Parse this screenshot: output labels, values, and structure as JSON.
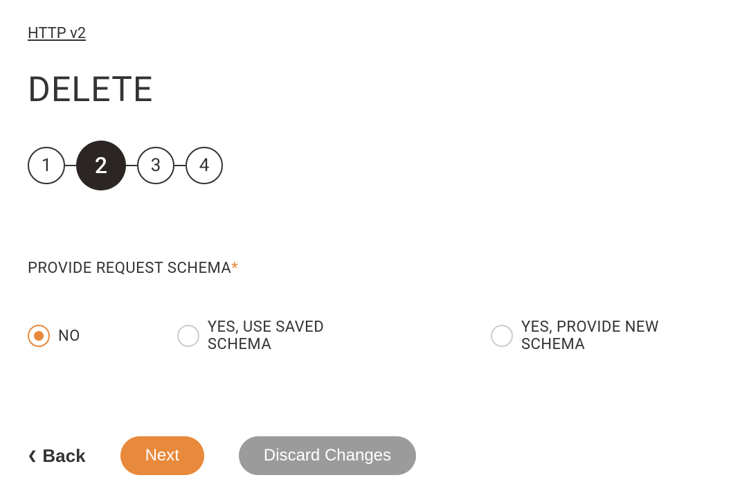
{
  "breadcrumb": {
    "label": "HTTP v2"
  },
  "page": {
    "title": "DELETE"
  },
  "stepper": {
    "steps": [
      {
        "number": "1",
        "active": false
      },
      {
        "number": "2",
        "active": true
      },
      {
        "number": "3",
        "active": false
      },
      {
        "number": "4",
        "active": false
      }
    ]
  },
  "form": {
    "section_label": "PROVIDE REQUEST SCHEMA",
    "required_mark": "*",
    "options": [
      {
        "label": "NO",
        "selected": true
      },
      {
        "label": "YES, USE SAVED SCHEMA",
        "selected": false
      },
      {
        "label": "YES, PROVIDE NEW SCHEMA",
        "selected": false
      }
    ]
  },
  "buttons": {
    "back": "Back",
    "next": "Next",
    "discard": "Discard Changes"
  }
}
